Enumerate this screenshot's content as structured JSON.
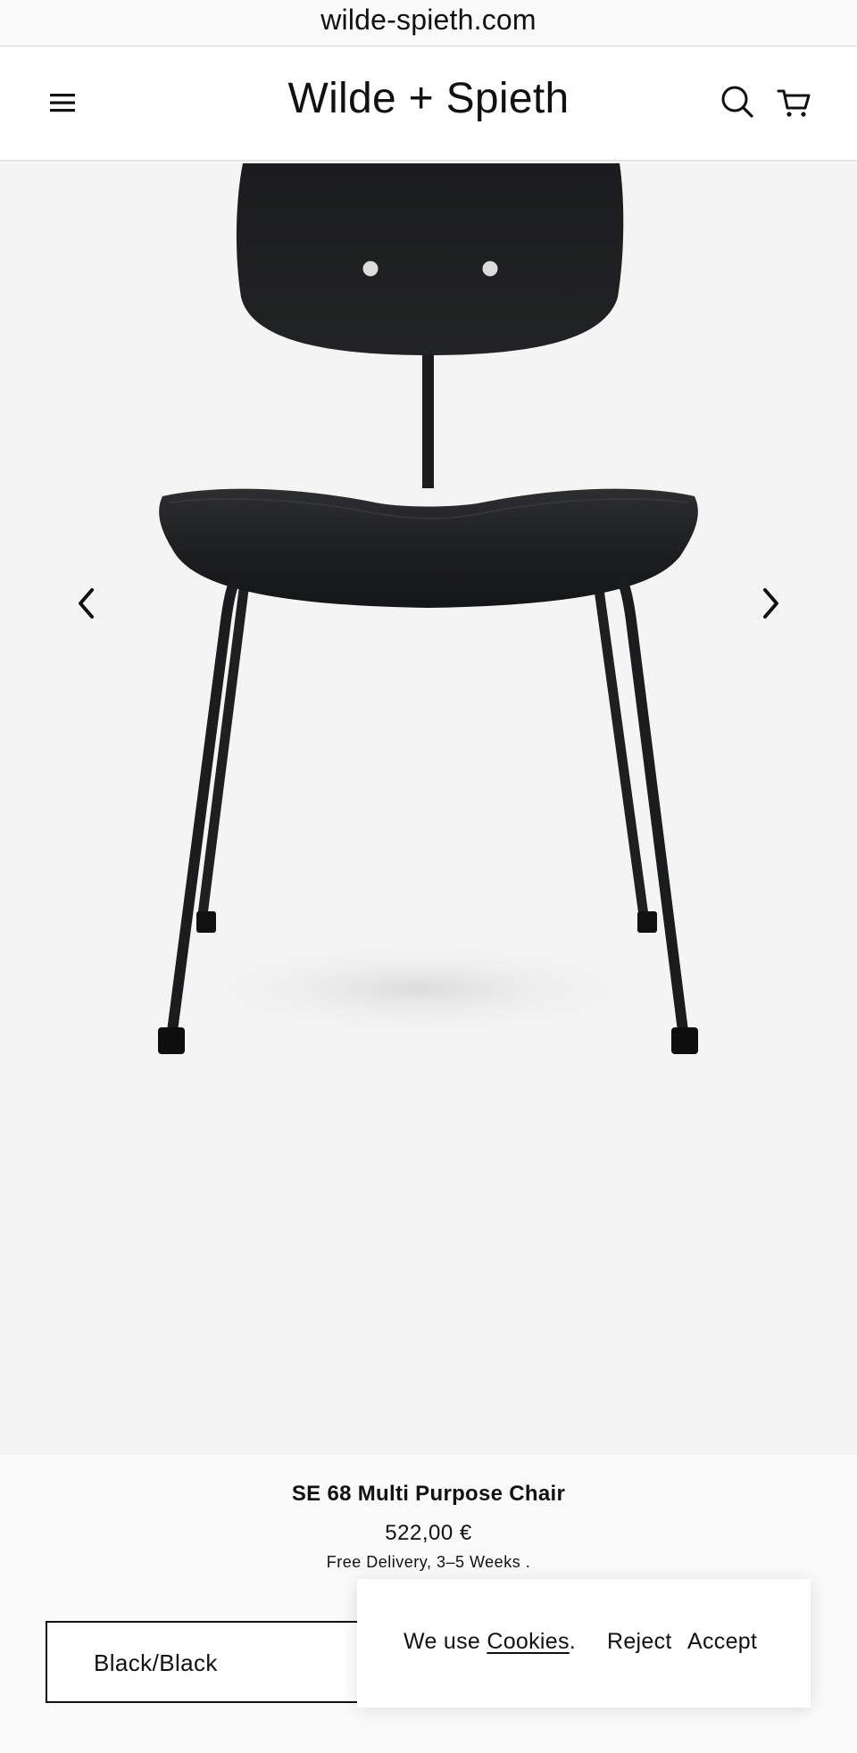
{
  "browser": {
    "url": "wilde-spieth.com"
  },
  "header": {
    "logo": "Wilde + Spieth",
    "menu_icon": "hamburger-menu-icon",
    "search_icon": "search-icon",
    "cart_icon": "shopping-cart-icon"
  },
  "gallery": {
    "image": "SE 68 Multi Purpose Chair black/black front view",
    "prev_icon": "chevron-left-icon",
    "next_icon": "chevron-right-icon"
  },
  "product": {
    "title": "SE 68 Multi Purpose Chair",
    "price": "522,00 €",
    "delivery": "Free Delivery, 3–5 Weeks ."
  },
  "variant": {
    "selected": "Black/Black"
  },
  "cookies": {
    "prefix": "We use ",
    "link": "Cookies",
    "suffix": ".",
    "reject": "Reject",
    "accept": "Accept"
  },
  "colors": {
    "background": "#f4f4f4",
    "text": "#111111",
    "chair": "#1e1f20"
  }
}
